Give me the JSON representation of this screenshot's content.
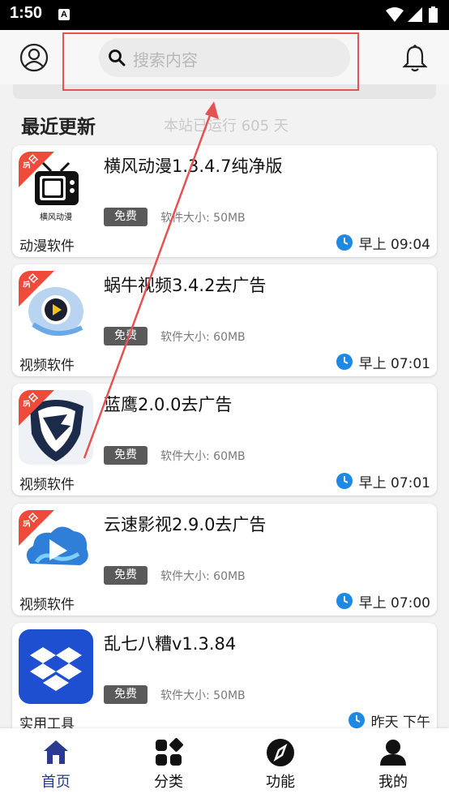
{
  "status_bar": {
    "time": "1:50",
    "notification_icon": "A"
  },
  "header": {
    "search_placeholder": "搜索内容",
    "user_icon": "user-circle-icon",
    "bell_icon": "bell-icon"
  },
  "section": {
    "title": "最近更新",
    "run_days": "本站已运行 605 天"
  },
  "apps": [
    {
      "name": "横风动漫1.3.4.7纯净版",
      "badge": "免费",
      "size": "软件大小: 50MB",
      "category": "动漫软件",
      "time": "早上 09:04",
      "ribbon": "今日",
      "logo_text": "横风动漫"
    },
    {
      "name": "蜗牛视频3.4.2去广告",
      "badge": "免费",
      "size": "软件大小: 60MB",
      "category": "视频软件",
      "time": "早上 07:01",
      "ribbon": "今日"
    },
    {
      "name": "蓝鹰2.0.0去广告",
      "badge": "免费",
      "size": "软件大小: 60MB",
      "category": "视频软件",
      "time": "早上 07:01",
      "ribbon": "今日"
    },
    {
      "name": "云速影视2.9.0去广告",
      "badge": "免费",
      "size": "软件大小: 60MB",
      "category": "视频软件",
      "time": "早上 07:00",
      "ribbon": "今日"
    },
    {
      "name": "乱七八糟v1.3.84",
      "badge": "免费",
      "size": "软件大小: 50MB",
      "category": "实用工具",
      "time": "昨天 下午"
    }
  ],
  "nav": [
    {
      "label": "首页",
      "icon": "home-icon",
      "active": true
    },
    {
      "label": "分类",
      "icon": "grid-icon"
    },
    {
      "label": "功能",
      "icon": "compass-icon"
    },
    {
      "label": "我的",
      "icon": "person-icon"
    }
  ],
  "colors": {
    "accent": "#2a3a8f",
    "ribbon": "#f04a3a",
    "annotation": "#e35353",
    "clock": "#1e88e5"
  }
}
